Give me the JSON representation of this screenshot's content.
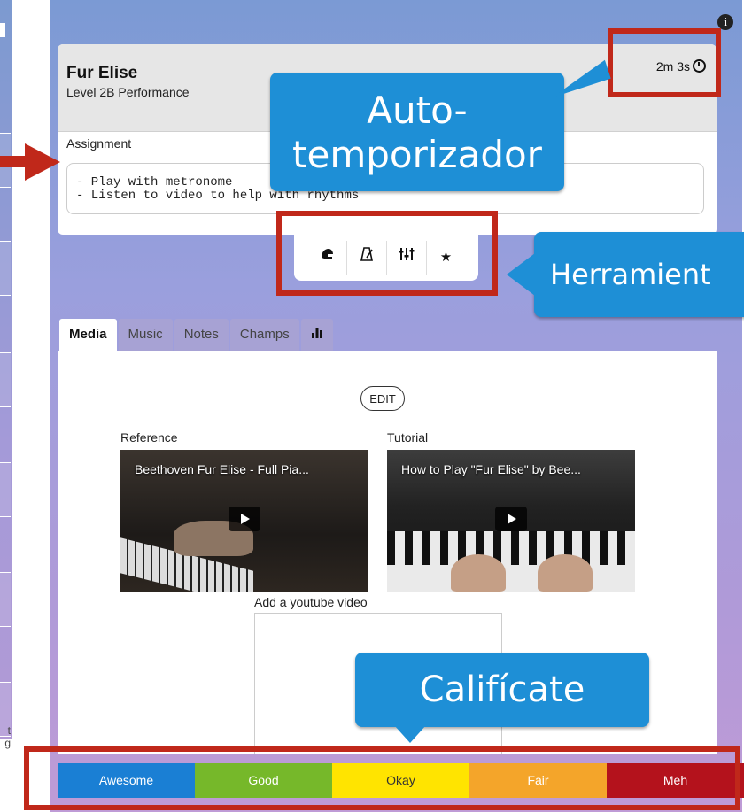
{
  "song": {
    "title": "Fur Elise",
    "subtitle": "Level 2B Performance",
    "timer": "2m 3s"
  },
  "assignment": {
    "label": "Assignment",
    "text": "- Play with metronome\n- Listen to video to help with rhythms"
  },
  "tools": [
    "helmet-icon",
    "metronome-icon",
    "tuner-sliders-icon",
    "star-icon"
  ],
  "tabs": [
    "Media",
    "Music",
    "Notes",
    "Champs"
  ],
  "media": {
    "edit_label": "EDIT",
    "reference_label": "Reference",
    "reference_title": "Beethoven Fur Elise - Full Pia...",
    "tutorial_label": "Tutorial",
    "tutorial_title": "How to Play \"Fur Elise\" by Bee...",
    "youtube_label": "Add a youtube video"
  },
  "rating": [
    {
      "label": "Awesome",
      "color": "#1a7fd4"
    },
    {
      "label": "Good",
      "color": "#76b82a"
    },
    {
      "label": "Okay",
      "color": "#ffe400"
    },
    {
      "label": "Fair",
      "color": "#f4a52a"
    },
    {
      "label": "Meh",
      "color": "#b4121c"
    }
  ],
  "annotations": {
    "timer_callout": "Auto-\ntemporizador",
    "tools_callout": "Herramient",
    "rate_callout": "Califícate"
  },
  "left_tail": "t\ng"
}
